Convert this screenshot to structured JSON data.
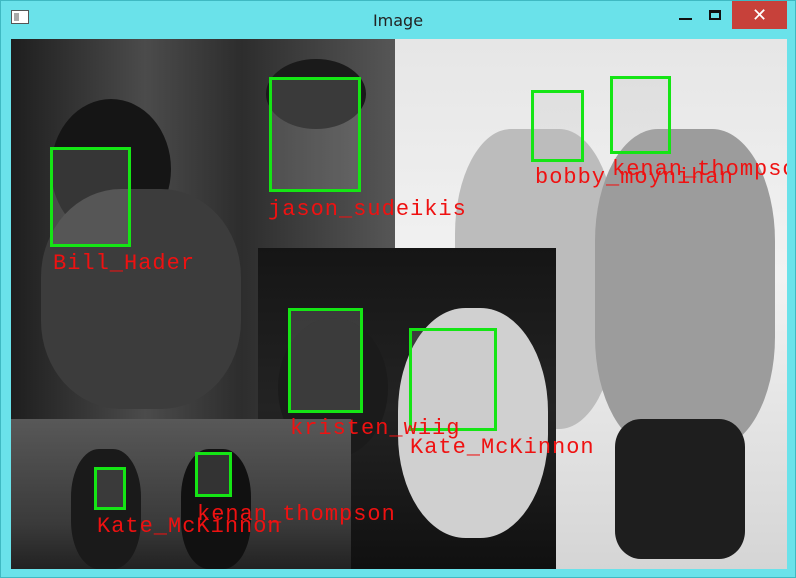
{
  "window": {
    "title": "Image",
    "close_glyph": "✕"
  },
  "detections": [
    {
      "name": "jason_sudeikis"
    },
    {
      "name": "Bill_Hader"
    },
    {
      "name": "bobby_moynihan"
    },
    {
      "name": "kenan_thompson"
    },
    {
      "name": "kristen_wiig"
    },
    {
      "name": "Kate_McKinnon"
    },
    {
      "name": "Kate_McKinnon"
    },
    {
      "name": "kenan_thompson"
    }
  ],
  "colors": {
    "box": "#15e515",
    "label": "#ef1111",
    "titlebar": "#6ae2ea",
    "close_button": "#c7413a"
  },
  "icons": [
    "app-icon",
    "minimize-icon",
    "maximize-icon",
    "close-icon"
  ]
}
